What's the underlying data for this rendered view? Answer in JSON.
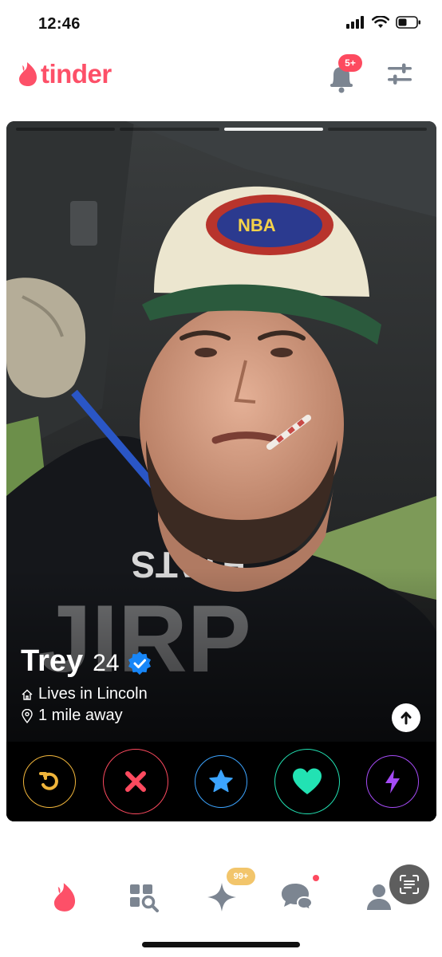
{
  "status_bar": {
    "time": "12:46",
    "icons": [
      "signal-icon",
      "wifi-icon",
      "battery-icon"
    ]
  },
  "header": {
    "logo_text": "tinder",
    "notification_badge": "5+",
    "icons": [
      "flame-icon",
      "bell-icon",
      "filter-icon"
    ]
  },
  "card": {
    "photo_count": 4,
    "active_photo": 3,
    "name": "Trey",
    "age": "24",
    "lives_in": "Lives in Lincoln",
    "distance": "1 mile away",
    "verified": true
  },
  "actions": [
    {
      "name": "rewind-button",
      "icon": "rewind-icon",
      "color": "#f0b53b"
    },
    {
      "name": "nope-button",
      "icon": "close-icon",
      "color": "#fd4a5f"
    },
    {
      "name": "super-like-button",
      "icon": "star-icon",
      "color": "#3ca4ff"
    },
    {
      "name": "like-button",
      "icon": "heart-icon",
      "color": "#22e2b3"
    },
    {
      "name": "boost-button",
      "icon": "lightning-icon",
      "color": "#a54bf6"
    }
  ],
  "bottom_nav": {
    "items": [
      "tab-home",
      "tab-explore",
      "tab-gold",
      "tab-messages",
      "tab-profile"
    ],
    "gold_badge": "99+",
    "colors": {
      "active": "#fd5068",
      "inactive": "#7c8591"
    }
  },
  "colors": {
    "brand": "#fd5068",
    "verified": "#1786f8"
  }
}
